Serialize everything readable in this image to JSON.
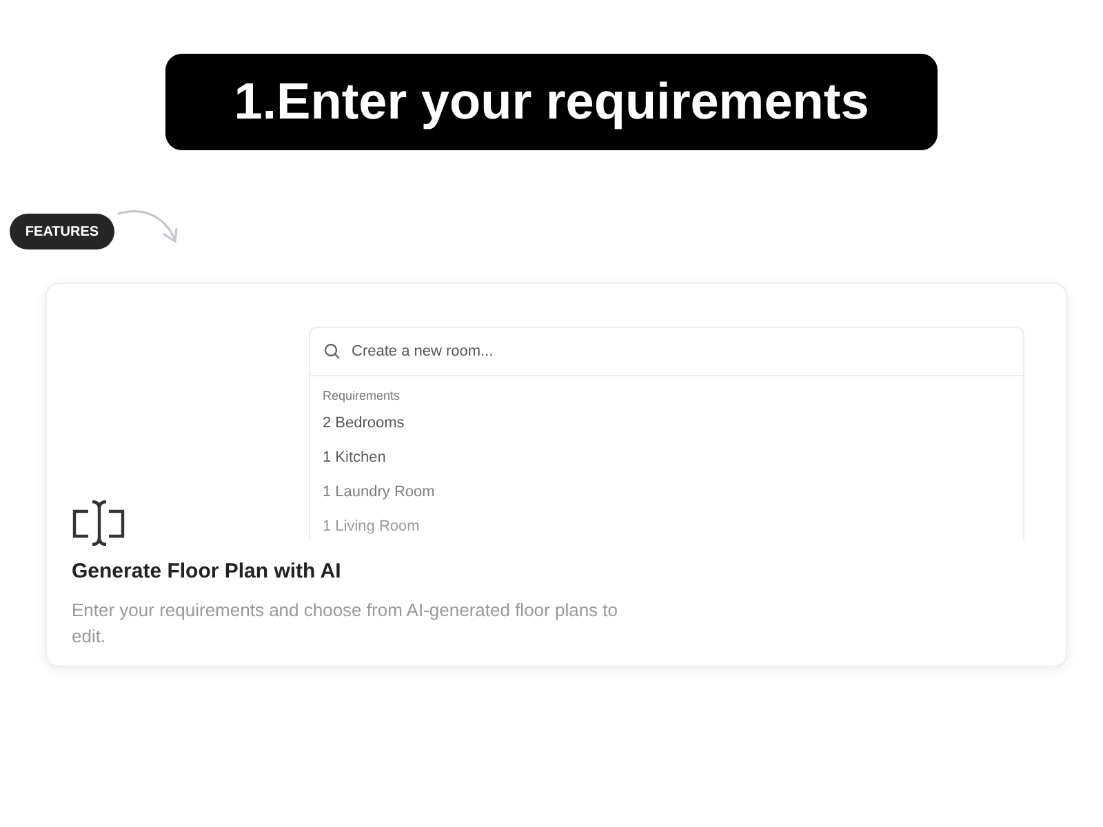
{
  "banner": {
    "title": "1.Enter your requirements"
  },
  "tag": {
    "label": "FEATURES"
  },
  "card": {
    "search": {
      "placeholder": "Create a new room..."
    },
    "list_heading": "Requirements",
    "items": [
      "2 Bedrooms",
      "1 Kitchen",
      "1 Laundry Room",
      "1 Living Room"
    ],
    "title": "Generate Floor Plan with AI",
    "description": "Enter your requirements and choose from AI-generated floor plans to edit."
  }
}
